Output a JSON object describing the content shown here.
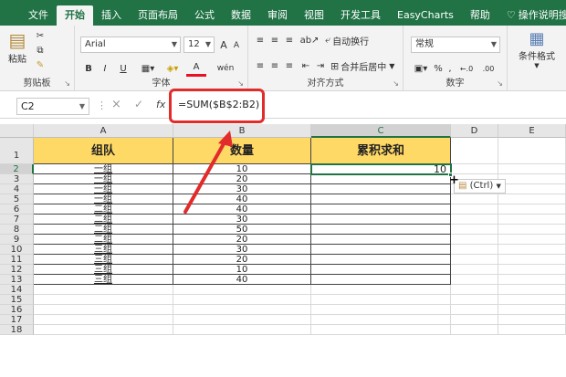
{
  "ribbon": {
    "tabs": [
      "文件",
      "开始",
      "插入",
      "页面布局",
      "公式",
      "数据",
      "审阅",
      "视图",
      "开发工具",
      "EasyCharts",
      "帮助",
      "操作说明搜索"
    ],
    "active_tab": "开始",
    "clipboard": {
      "paste_label": "粘贴",
      "group_label": "剪贴板"
    },
    "font": {
      "name": "Arial",
      "size": "12",
      "grow": "A",
      "shrink": "A",
      "bold": "B",
      "italic": "I",
      "underline": "U",
      "color_a": "A",
      "phonetic": "wén",
      "group_label": "字体"
    },
    "alignment": {
      "wrap_label": "自动换行",
      "merge_label": "合并后居中",
      "group_label": "对齐方式"
    },
    "number": {
      "format": "常规",
      "percent": "%",
      "comma": ",",
      "inc_dec": "←.0 .00",
      "dec_dec": ".00 →.0",
      "group_label": "数字"
    },
    "styles": {
      "cond_format_label": "条件格式"
    }
  },
  "formula_bar": {
    "name_box": "C2",
    "cancel": "×",
    "enter": "✓",
    "fx": "fx",
    "formula": "=SUM($B$2:B2)"
  },
  "sheet": {
    "columns": [
      "A",
      "B",
      "C",
      "D",
      "E"
    ],
    "row_numbers": [
      "1",
      "2",
      "3",
      "4",
      "5",
      "6",
      "7",
      "8",
      "9",
      "10",
      "11",
      "12",
      "13",
      "14",
      "15",
      "16",
      "17",
      "18"
    ],
    "headers": {
      "a": "组队",
      "b": "数量",
      "c": "累积求和"
    },
    "rows": [
      {
        "team": "一组",
        "qty": "10",
        "cum": "10"
      },
      {
        "team": "一组",
        "qty": "20",
        "cum": ""
      },
      {
        "team": "一组",
        "qty": "30",
        "cum": ""
      },
      {
        "team": "一组",
        "qty": "40",
        "cum": ""
      },
      {
        "team": "二组",
        "qty": "40",
        "cum": ""
      },
      {
        "team": "二组",
        "qty": "30",
        "cum": ""
      },
      {
        "team": "二组",
        "qty": "50",
        "cum": ""
      },
      {
        "team": "二组",
        "qty": "20",
        "cum": ""
      },
      {
        "team": "三组",
        "qty": "30",
        "cum": ""
      },
      {
        "team": "三组",
        "qty": "20",
        "cum": ""
      },
      {
        "team": "三组",
        "qty": "10",
        "cum": ""
      },
      {
        "team": "三组",
        "qty": "40",
        "cum": ""
      }
    ],
    "paste_options": "(Ctrl)",
    "header_fill": "#ffd966",
    "accent": "#217346",
    "annotation_color": "#e22b2b"
  }
}
